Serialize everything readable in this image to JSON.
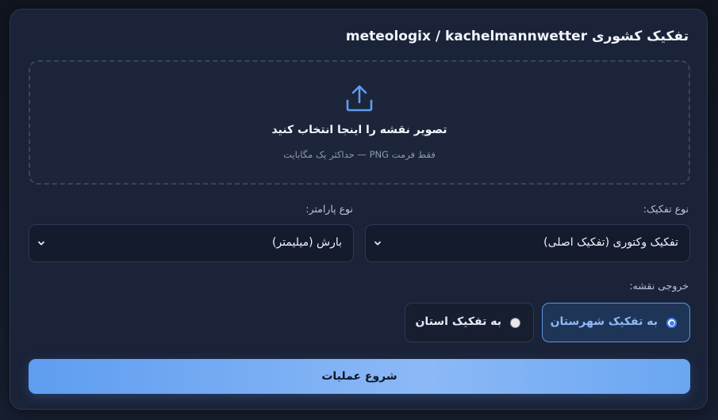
{
  "page": {
    "title": "تفکیک کشوری meteologix / kachelmannwetter"
  },
  "upload": {
    "icon": "upload-icon",
    "title": "تصویر نقشه را اینجا انتخاب کنید",
    "subtitle": "فقط فرمت PNG — حداکثر یک مگابایت"
  },
  "split_type": {
    "label": "نوع تفکیک:",
    "selected": "تفکیک وکتوری (تفکیک اصلی)"
  },
  "parameter_type": {
    "label": "نوع پارامتر:",
    "selected": "بارش (میلیمتر)"
  },
  "map_output": {
    "label": "خروجی نقشه:",
    "options": [
      {
        "label": "به تفکیک شهرستان",
        "selected": true
      },
      {
        "label": "به تفکیک استان",
        "selected": false
      }
    ]
  },
  "actions": {
    "start_label": "شروع عملیات"
  },
  "colors": {
    "accent": "#5e9df0",
    "card_bg": "#1a2338",
    "active_radio_border": "#5b95e0"
  }
}
